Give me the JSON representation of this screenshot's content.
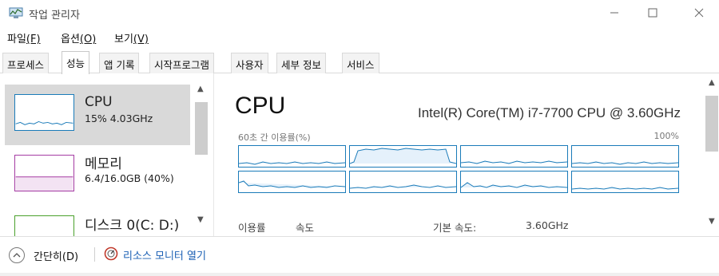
{
  "window": {
    "title": "작업 관리자",
    "controls": {
      "minimize": "—",
      "maximize": "☐",
      "close": "✕"
    }
  },
  "menu": [
    {
      "label": "파일",
      "accel": "(F)"
    },
    {
      "label": "옵션",
      "accel": "(O)"
    },
    {
      "label": "보기",
      "accel": "(V)"
    }
  ],
  "tabs": [
    "프로세스",
    "성능",
    "앱 기록",
    "시작프로그램",
    "사용자",
    "세부 정보",
    "서비스"
  ],
  "active_tab": "성능",
  "sidebar": {
    "items": [
      {
        "title": "CPU",
        "subtitle": "15%  4.03GHz",
        "color": "#1a7bb9",
        "selected": true
      },
      {
        "title": "메모리",
        "subtitle": "6.4/16.0GB (40%)",
        "color": "#a53ca3",
        "selected": false
      },
      {
        "title": "디스크 0(C: D:)",
        "subtitle": "",
        "color": "#4aa02c",
        "selected": false
      }
    ]
  },
  "main": {
    "title": "CPU",
    "model": "Intel(R) Core(TM) i7-7700 CPU @ 3.60GHz",
    "util_label": "60초 간 이용률(%)",
    "util_max": "100%",
    "stats": {
      "utilization_label": "이용률",
      "speed_label": "속도",
      "base_speed_label": "기본 속도:",
      "base_speed_value": "3.60GHz"
    }
  },
  "footer": {
    "collapse_label": "간단히(D)",
    "resource_monitor_label": "리소스 모니터 열기"
  },
  "colors": {
    "cpu_accent": "#1a7bb9",
    "memory_accent": "#a53ca3",
    "disk_accent": "#4aa02c",
    "link": "#1a5fb4",
    "selected_bg": "#d9d9d9"
  }
}
